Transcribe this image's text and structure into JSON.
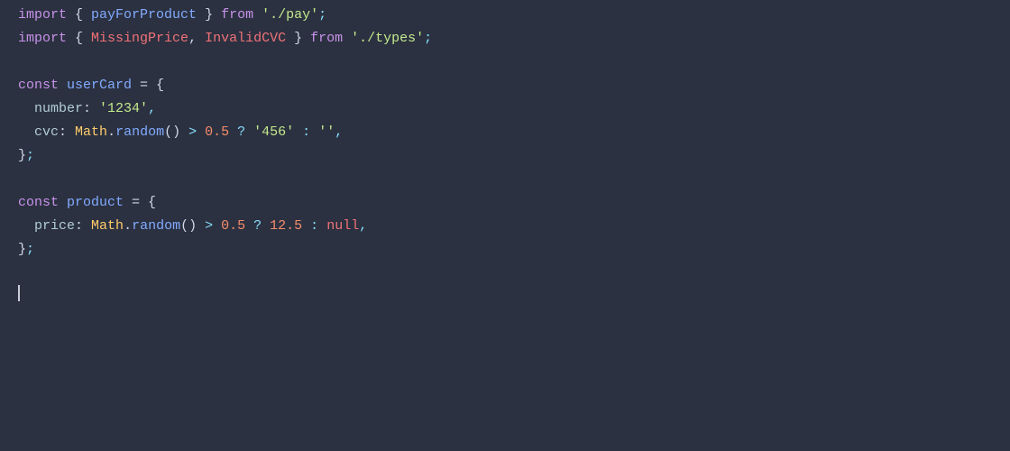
{
  "editor": {
    "background": "#2b3140",
    "lines": [
      {
        "id": "line1",
        "tokens": [
          {
            "text": "import",
            "cls": "kw-import"
          },
          {
            "text": " { ",
            "cls": "plain"
          },
          {
            "text": "payForProduct",
            "cls": "identifier"
          },
          {
            "text": " } ",
            "cls": "plain"
          },
          {
            "text": "from",
            "cls": "kw-from"
          },
          {
            "text": " ",
            "cls": "plain"
          },
          {
            "text": "'./pay'",
            "cls": "string"
          },
          {
            "text": ";",
            "cls": "semicolon"
          }
        ]
      },
      {
        "id": "line2",
        "tokens": [
          {
            "text": "import",
            "cls": "kw-import"
          },
          {
            "text": " { ",
            "cls": "plain"
          },
          {
            "text": "MissingPrice",
            "cls": "identifier-err"
          },
          {
            "text": ", ",
            "cls": "plain"
          },
          {
            "text": "InvalidCVC",
            "cls": "identifier-err"
          },
          {
            "text": " } ",
            "cls": "plain"
          },
          {
            "text": "from",
            "cls": "kw-from"
          },
          {
            "text": " ",
            "cls": "plain"
          },
          {
            "text": "'./types'",
            "cls": "string"
          },
          {
            "text": ";",
            "cls": "semicolon"
          }
        ]
      },
      {
        "id": "line3",
        "tokens": []
      },
      {
        "id": "line4",
        "tokens": [
          {
            "text": "const",
            "cls": "kw-const"
          },
          {
            "text": " ",
            "cls": "plain"
          },
          {
            "text": "userCard",
            "cls": "identifier"
          },
          {
            "text": " = {",
            "cls": "plain"
          }
        ]
      },
      {
        "id": "line5",
        "tokens": [
          {
            "text": "  ",
            "cls": "plain"
          },
          {
            "text": "number",
            "cls": "property"
          },
          {
            "text": ": ",
            "cls": "plain"
          },
          {
            "text": "'1234'",
            "cls": "string"
          },
          {
            "text": ",",
            "cls": "comma"
          }
        ]
      },
      {
        "id": "line6",
        "tokens": [
          {
            "text": "  ",
            "cls": "plain"
          },
          {
            "text": "cvc",
            "cls": "property"
          },
          {
            "text": ": ",
            "cls": "plain"
          },
          {
            "text": "Math",
            "cls": "math-obj"
          },
          {
            "text": ".",
            "cls": "plain"
          },
          {
            "text": "random",
            "cls": "random-fn"
          },
          {
            "text": "()",
            "cls": "plain"
          },
          {
            "text": " > ",
            "cls": "operator"
          },
          {
            "text": "0.5",
            "cls": "number-lit"
          },
          {
            "text": " ? ",
            "cls": "operator"
          },
          {
            "text": "'456'",
            "cls": "string"
          },
          {
            "text": " : ",
            "cls": "operator"
          },
          {
            "text": "''",
            "cls": "string"
          },
          {
            "text": ",",
            "cls": "comma"
          }
        ]
      },
      {
        "id": "line7",
        "tokens": [
          {
            "text": "}",
            "cls": "plain"
          },
          {
            "text": ";",
            "cls": "semicolon"
          }
        ]
      },
      {
        "id": "line8",
        "tokens": []
      },
      {
        "id": "line9",
        "tokens": [
          {
            "text": "const",
            "cls": "kw-const"
          },
          {
            "text": " ",
            "cls": "plain"
          },
          {
            "text": "product",
            "cls": "identifier"
          },
          {
            "text": " = {",
            "cls": "plain"
          }
        ]
      },
      {
        "id": "line10",
        "tokens": [
          {
            "text": "  ",
            "cls": "plain"
          },
          {
            "text": "price",
            "cls": "property"
          },
          {
            "text": ": ",
            "cls": "plain"
          },
          {
            "text": "Math",
            "cls": "math-obj"
          },
          {
            "text": ".",
            "cls": "plain"
          },
          {
            "text": "random",
            "cls": "random-fn"
          },
          {
            "text": "()",
            "cls": "plain"
          },
          {
            "text": " > ",
            "cls": "operator"
          },
          {
            "text": "0.5",
            "cls": "number-lit"
          },
          {
            "text": " ? ",
            "cls": "operator"
          },
          {
            "text": "12.5",
            "cls": "number-lit"
          },
          {
            "text": " : ",
            "cls": "operator"
          },
          {
            "text": "null",
            "cls": "null-kw"
          },
          {
            "text": ",",
            "cls": "comma"
          }
        ]
      },
      {
        "id": "line11",
        "tokens": [
          {
            "text": "}",
            "cls": "plain"
          },
          {
            "text": ";",
            "cls": "semicolon"
          }
        ]
      },
      {
        "id": "line12",
        "tokens": []
      },
      {
        "id": "line13",
        "tokens": [],
        "cursor": true
      }
    ]
  }
}
